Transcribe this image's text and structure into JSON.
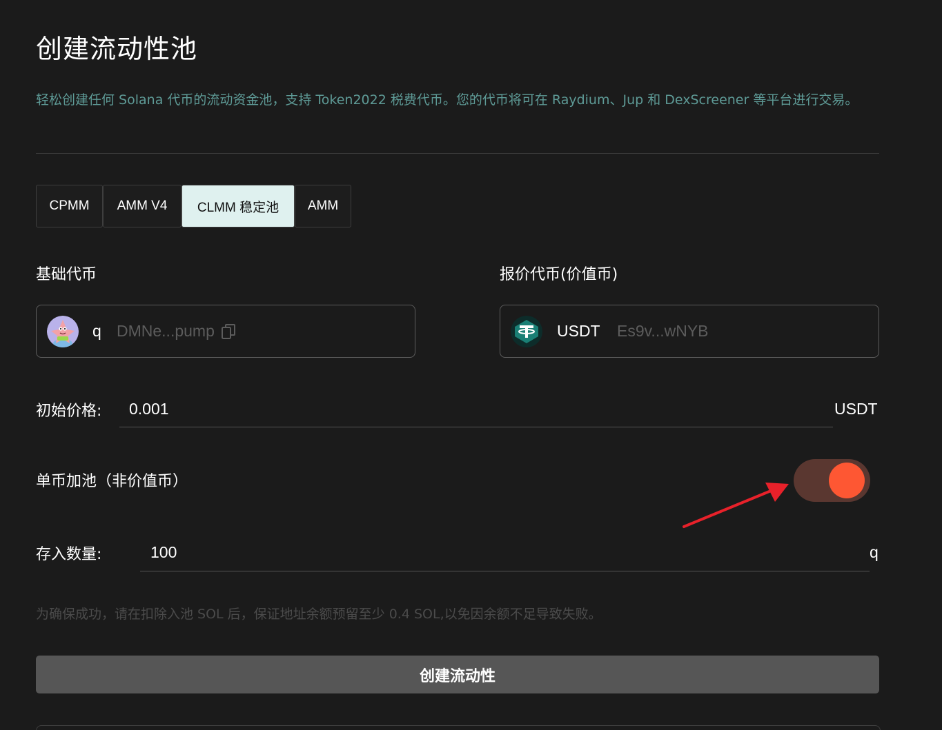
{
  "page": {
    "title": "创建流动性池",
    "description": "轻松创建任何 Solana 代币的流动资金池，支持 Token2022 税费代币。您的代币将可在 Raydium、Jup 和 DexScreener 等平台进行交易。"
  },
  "tabs": [
    {
      "label": "CPMM",
      "active": false
    },
    {
      "label": "AMM V4",
      "active": false
    },
    {
      "label": "CLMM 稳定池",
      "active": true
    },
    {
      "label": "AMM",
      "active": false
    }
  ],
  "base_token": {
    "label": "基础代币",
    "symbol": "q",
    "address": "DMNe...pump",
    "icon": "patrick-star-avatar"
  },
  "quote_token": {
    "label": "报价代币(价值币)",
    "symbol": "USDT",
    "address": "Es9v...wNYB",
    "icon": "tether-logo"
  },
  "price": {
    "label": "初始价格:",
    "value": "0.001",
    "unit": "USDT"
  },
  "single_side": {
    "label": "单币加池（非价值币）",
    "enabled": true,
    "toggle_color": "#fe5733"
  },
  "amount": {
    "label": "存入数量:",
    "value": "100",
    "unit": "q"
  },
  "note": "为确保成功，请在扣除入池 SOL 后，保证地址余额预留至少 0.4 SOL,以免因余额不足导致失败。",
  "submit": {
    "label": "创建流动性"
  },
  "colors": {
    "background": "#1b1b1b",
    "accent_teal": "#5e9a96",
    "active_tab": "#dff1ef",
    "arrow": "#e8212a"
  }
}
